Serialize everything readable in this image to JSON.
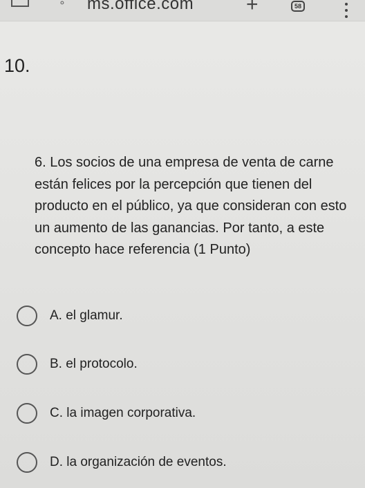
{
  "browser": {
    "url": "ms.office.com",
    "tab_count": "58",
    "icons": [
      "home-icon",
      "site-info-icon",
      "new-tab-icon",
      "tab-switcher-icon",
      "more-menu-icon"
    ]
  },
  "question_number": "10.",
  "question_text": "6. Los socios de una empresa de venta de carne están felices por la percepción que tienen del producto en el público, ya que consideran con esto un aumento de las ganancias. Por tanto, a este concepto hace referencia (1 Punto)",
  "options": [
    {
      "label": "A. el glamur."
    },
    {
      "label": "B. el protocolo."
    },
    {
      "label": "C. la imagen corporativa."
    },
    {
      "label": "D. la organización de eventos."
    }
  ]
}
